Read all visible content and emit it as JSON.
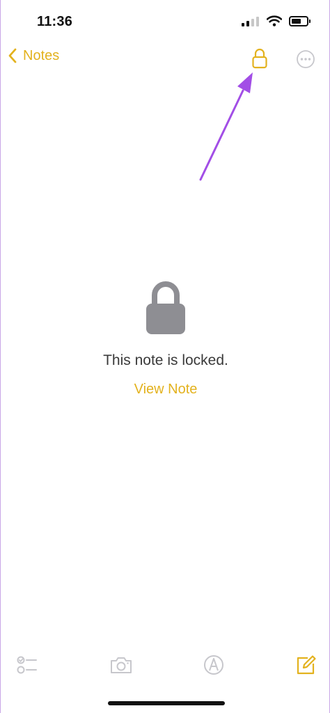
{
  "status_bar": {
    "time": "11:36",
    "battery_level": 0.65
  },
  "nav": {
    "back_label": "Notes",
    "back_icon": "chevron-left-icon",
    "lock_icon": "lock-open-icon",
    "more_icon": "ellipsis-circle-icon"
  },
  "content": {
    "lock_icon": "lock-icon",
    "locked_message": "This note is locked.",
    "view_note_label": "View Note"
  },
  "toolbar": {
    "checklist_icon": "checklist-icon",
    "camera_icon": "camera-icon",
    "markup_icon": "markup-pen-icon",
    "compose_icon": "compose-icon"
  },
  "colors": {
    "accent": "#e3b21e",
    "annotation_arrow": "#a24ee6",
    "lock_gray": "#8e8e93",
    "disabled_gray": "#c7c7cc",
    "text_primary": "#3a3a3a"
  }
}
